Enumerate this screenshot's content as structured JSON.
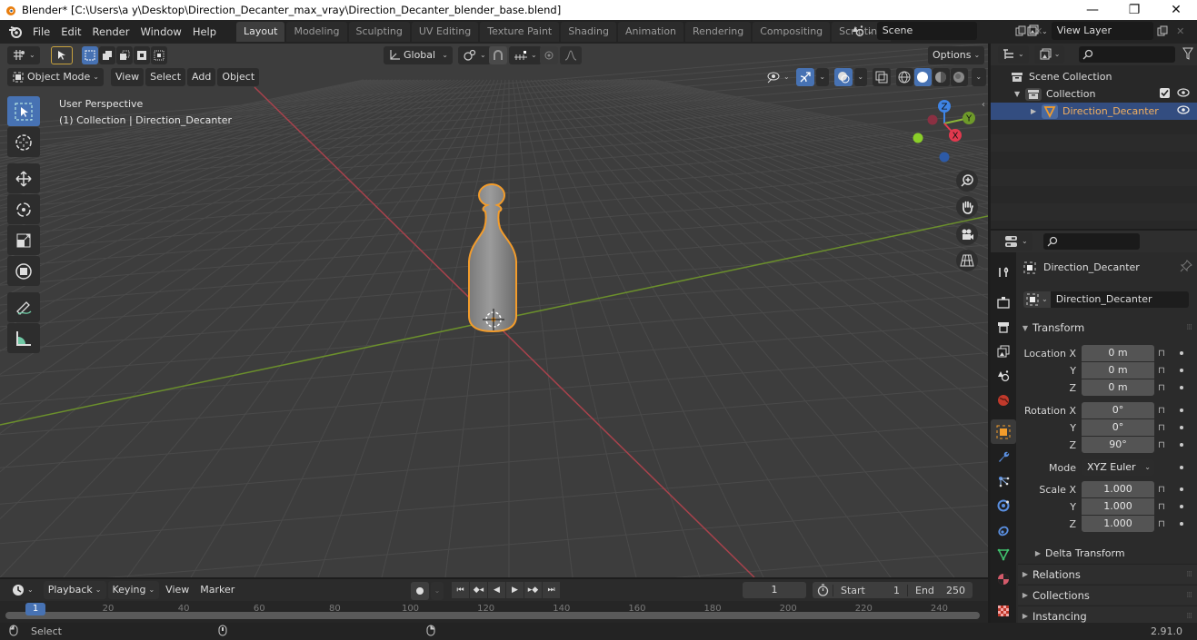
{
  "window": {
    "title": "Blender* [C:\\Users\\a y\\Desktop\\Direction_Decanter_max_vray\\Direction_Decanter_blender_base.blend]",
    "minimize": "—",
    "maximize": "❐",
    "close": "✕"
  },
  "menu": [
    "File",
    "Edit",
    "Render",
    "Window",
    "Help"
  ],
  "workspaces": [
    {
      "label": "Layout",
      "active": true
    },
    {
      "label": "Modeling"
    },
    {
      "label": "Sculpting"
    },
    {
      "label": "UV Editing"
    },
    {
      "label": "Texture Paint"
    },
    {
      "label": "Shading"
    },
    {
      "label": "Animation"
    },
    {
      "label": "Rendering"
    },
    {
      "label": "Compositing"
    },
    {
      "label": "Scripting"
    }
  ],
  "workspace_add": "+",
  "scene": {
    "name": "Scene"
  },
  "view_layer": {
    "name": "View Layer"
  },
  "viewport": {
    "transform_orientation": "Global",
    "options_label": "Options",
    "mode": "Object Mode",
    "header_menus": [
      "View",
      "Select",
      "Add",
      "Object"
    ],
    "overlay_line1": "User Perspective",
    "overlay_line2": "(1) Collection | Direction_Decanter",
    "gizmo_axes": {
      "x": "X",
      "y": "Y",
      "z": "Z"
    },
    "colors": {
      "x_axis": "#a8424c",
      "y_axis": "#6b8f2c",
      "selection": "#f39c2b",
      "active_tool": "#4772b3"
    }
  },
  "tools": [
    "select-box",
    "cursor",
    "move",
    "rotate",
    "scale",
    "transform",
    "annotate",
    "measure"
  ],
  "outliner": {
    "root": "Scene Collection",
    "collection": "Collection",
    "object": "Direction_Decanter"
  },
  "properties": {
    "object_name": "Direction_Decanter",
    "data_name": "Direction_Decanter",
    "transform_label": "Transform",
    "location": {
      "label": "Location X",
      "x": "0 m",
      "y": "0 m",
      "z": "0 m"
    },
    "rotation": {
      "label": "Rotation X",
      "x": "0°",
      "y": "0°",
      "z": "90°"
    },
    "mode_label": "Mode",
    "mode_value": "XYZ Euler",
    "scale": {
      "label": "Scale X",
      "x": "1.000",
      "y": "1.000",
      "z": "1.000"
    },
    "axis_y": "Y",
    "axis_z": "Z",
    "delta_transform": "Delta Transform",
    "relations": "Relations",
    "collections": "Collections",
    "instancing": "Instancing"
  },
  "timeline": {
    "menus": [
      "Playback",
      "Keying",
      "View",
      "Marker"
    ],
    "current_frame": "1",
    "start_label": "Start",
    "start": "1",
    "end_label": "End",
    "end": "250",
    "ticks": [
      "20",
      "40",
      "60",
      "80",
      "100",
      "120",
      "140",
      "160",
      "180",
      "200",
      "220",
      "240"
    ],
    "marker": "1"
  },
  "statusbar": {
    "select_label": "Select",
    "version": "2.91.0"
  }
}
